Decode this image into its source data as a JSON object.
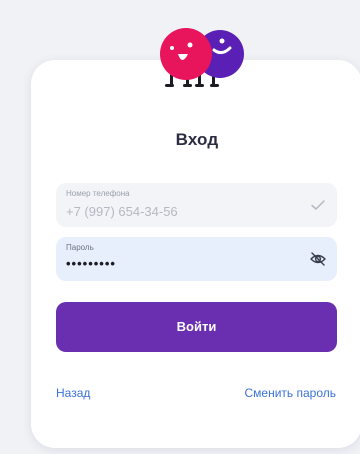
{
  "form": {
    "title": "Вход",
    "phone_label": "Номер телефона",
    "phone_value": "+7 (997) 654-34-56",
    "password_label": "Пароль",
    "password_value": "•••••••••",
    "submit_label": "Войти"
  },
  "links": {
    "back_label": "Назад",
    "change_password_label": "Сменить пароль"
  },
  "icons": {
    "mascot": "mascot-logo-icon",
    "phone_status": "checkmark-icon",
    "password_toggle": "eye-off-icon"
  },
  "colors": {
    "accent": "#6a2fb0",
    "link": "#3b73d6",
    "mascot_red": "#e8145c",
    "mascot_purple": "#5a1fb5"
  }
}
